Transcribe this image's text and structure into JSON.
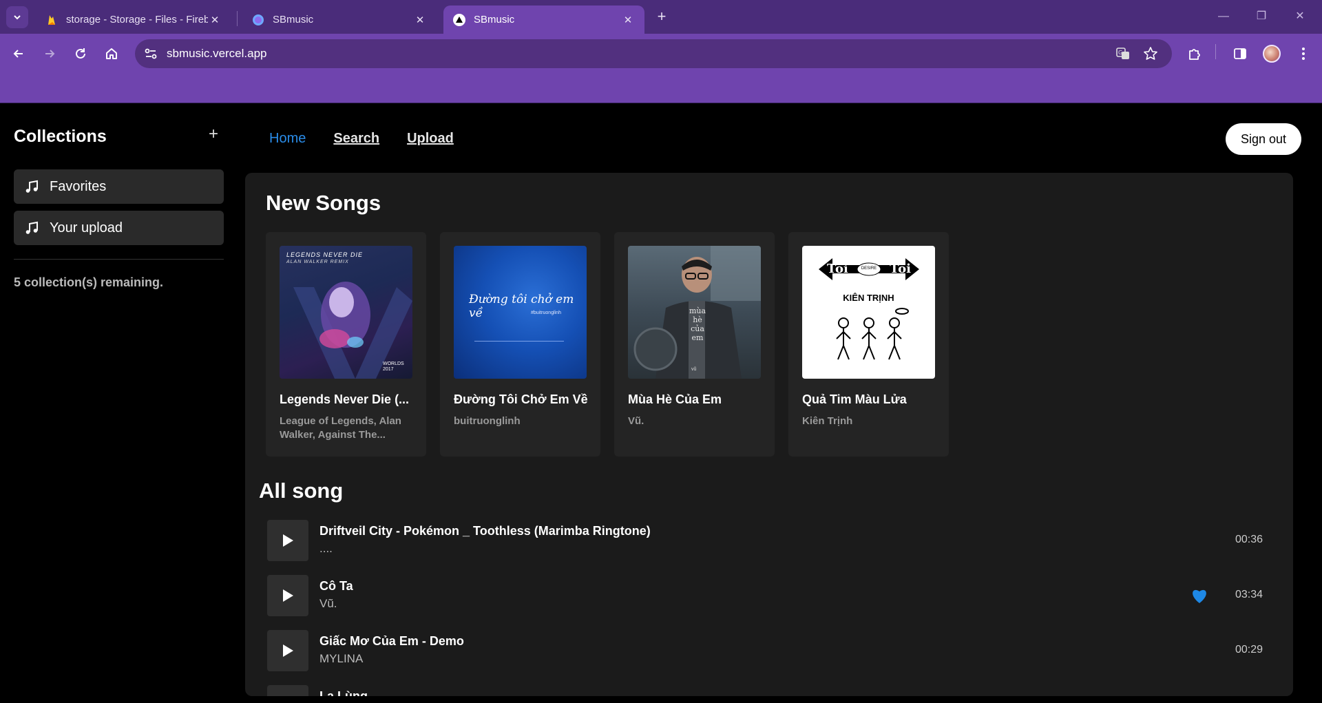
{
  "browser": {
    "tabs": [
      {
        "title": "storage - Storage - Files - Fireba",
        "icon": "firebase-icon"
      },
      {
        "title": "SBmusic",
        "icon": "sbmusic-favicon"
      },
      {
        "title": "SBmusic",
        "icon": "vercel-icon",
        "active": true
      }
    ],
    "url": "sbmusic.vercel.app"
  },
  "sidebar": {
    "title": "Collections",
    "items": [
      {
        "label": "Favorites"
      },
      {
        "label": "Your upload"
      }
    ],
    "remaining": "5 collection(s) remaining."
  },
  "nav": {
    "home": "Home",
    "search": "Search",
    "upload": "Upload",
    "signout": "Sign out"
  },
  "new_songs": {
    "title": "New Songs",
    "cards": [
      {
        "title": "Legends Never Die (...",
        "artist": "League of Legends, Alan Walker, Against The...",
        "cover_text": "LEGENDS NEVER DIE",
        "cover_sub": "ALAN WALKER REMIX",
        "cover_badge": "WORLDS 2017"
      },
      {
        "title": "Đường Tôi Chở Em Về",
        "artist": "buitruonglinh",
        "cover_text": "Đường tôi chở em về",
        "cover_sub": "#buitruonglinh"
      },
      {
        "title": "Mùa Hè Của Em",
        "artist": "Vũ.",
        "cover_text": "mùa hè của em",
        "cover_sub": "vũ"
      },
      {
        "title": "Quả Tim Màu Lửa",
        "artist": "Kiên Trịnh",
        "cover_text": "Tôi Tôi",
        "cover_mid": "DESIRE",
        "cover_sub": "KIÊN TRỊNH"
      }
    ]
  },
  "all_songs": {
    "title": "All song",
    "rows": [
      {
        "title": "Driftveil City - Pokémon _ Toothless (Marimba Ringtone)",
        "artist": "....",
        "duration": "00:36",
        "favorite": false
      },
      {
        "title": "Cô Ta",
        "artist": "Vũ.",
        "duration": "03:34",
        "favorite": true
      },
      {
        "title": "Giấc Mơ Của Em - Demo",
        "artist": "MYLINA",
        "duration": "00:29",
        "favorite": false
      },
      {
        "title": "La Lùng",
        "artist": "",
        "duration": "",
        "favorite": false
      }
    ]
  },
  "colors": {
    "accent": "#2a8ce8",
    "browser_frame": "#6f44ae",
    "heart": "#1e88e5"
  }
}
